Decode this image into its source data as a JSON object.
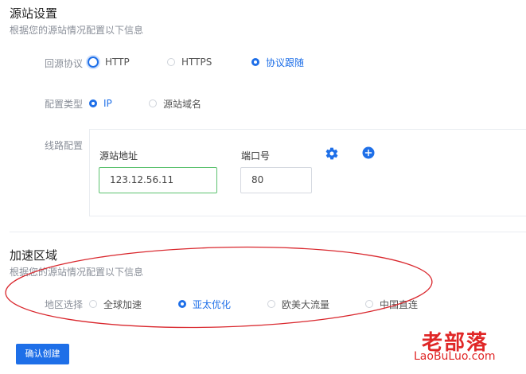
{
  "origin": {
    "title": "源站设置",
    "desc": "根据您的源站情况配置以下信息",
    "protocol": {
      "label": "回源协议",
      "options": [
        "HTTP",
        "HTTPS",
        "协议跟随"
      ],
      "selected": "协议跟随"
    },
    "config_type": {
      "label": "配置类型",
      "options": [
        "IP",
        "源站域名"
      ],
      "selected": "IP"
    },
    "line": {
      "label": "线路配置",
      "address_label": "源站地址",
      "address_value": "123.12.56.11",
      "port_label": "端口号",
      "port_value": "80"
    }
  },
  "accel": {
    "title": "加速区域",
    "desc": "根据您的源站情况配置以下信息",
    "region": {
      "label": "地区选择",
      "options": [
        "全球加速",
        "亚太优化",
        "欧美大流量",
        "中国直连"
      ],
      "selected": "亚太优化"
    }
  },
  "confirm_label": "确认创建",
  "watermark": {
    "main": "老部落",
    "sub": "LaoBuLuo.com"
  },
  "colors": {
    "accent": "#1e6fe8",
    "success_border": "#5cc26f",
    "annotation_red": "#d9262c"
  },
  "icons": {
    "settings": "gear-icon",
    "add": "plus-circle-icon"
  }
}
